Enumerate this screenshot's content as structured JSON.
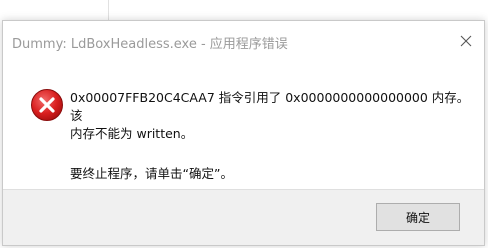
{
  "dialog": {
    "title": "Dummy: LdBoxHeadless.exe - 应用程序错误",
    "icon": "error-icon",
    "close_icon": "close-icon",
    "message_line1": "0x00007FFB20C4CAA7 指令引用了 0x0000000000000000 内存。该",
    "message_line2": "内存不能为 written。",
    "message_question": "要终止程序，请单击“确定”。",
    "ok_label": "确定"
  },
  "colors": {
    "error_red": "#d71f1f",
    "title_gray": "#9a9a9a",
    "footer_bg": "#f0f0f0"
  }
}
